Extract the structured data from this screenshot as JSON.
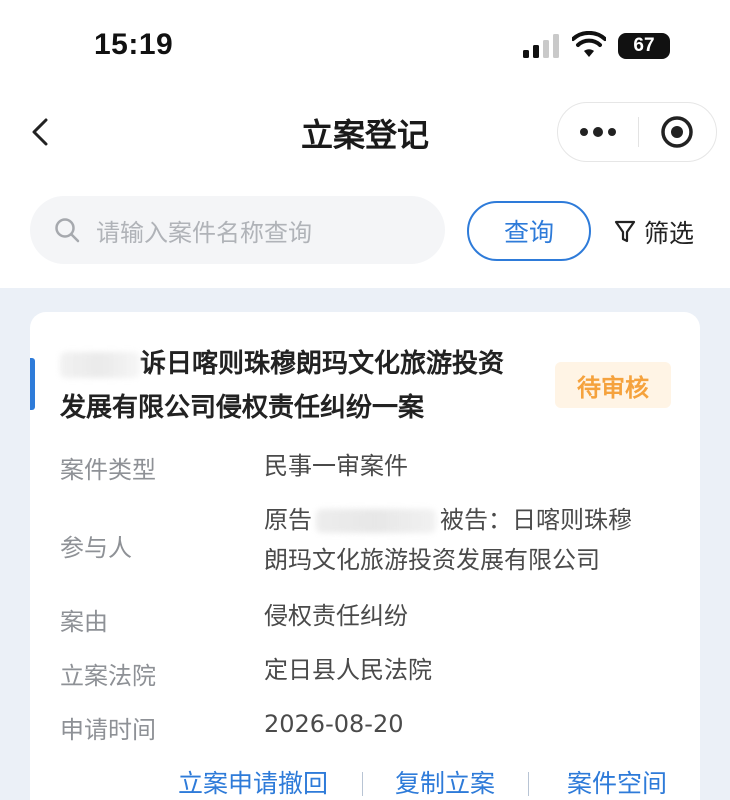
{
  "status_bar": {
    "time": "15:19",
    "battery": "67"
  },
  "nav": {
    "title": "立案登记",
    "back_icon": "chevron-left-icon",
    "more_icon": "more-dots-icon",
    "target_icon": "target-icon"
  },
  "search": {
    "placeholder": "请输入案件名称查询",
    "query_label": "查询",
    "filter_label": "筛选"
  },
  "colors": {
    "accent": "#2e7bd9",
    "badge_text": "#f5a23d",
    "badge_bg": "#fff4e5",
    "content_bg": "#ebf0f7"
  },
  "case": {
    "title_line1": "诉日喀则珠穆朗玛文化旅游投资",
    "title_line2": "发展有限公司侵权责任纠纷一案",
    "status": "待审核",
    "fields": [
      {
        "label": "案件类型",
        "value": "民事一审案件"
      },
      {
        "label": "参与人",
        "value_prefix": "原告",
        "value_line1_suffix": "被告：日喀则珠穆",
        "value_line2": "朗玛文化旅游投资发展有限公司"
      },
      {
        "label": "案由",
        "value": "侵权责任纠纷"
      },
      {
        "label": "立案法院",
        "value": "定日县人民法院"
      },
      {
        "label": "申请时间",
        "value": "2026-08-20"
      }
    ],
    "actions": [
      "立案申请撤回",
      "复制立案",
      "案件空间"
    ]
  }
}
